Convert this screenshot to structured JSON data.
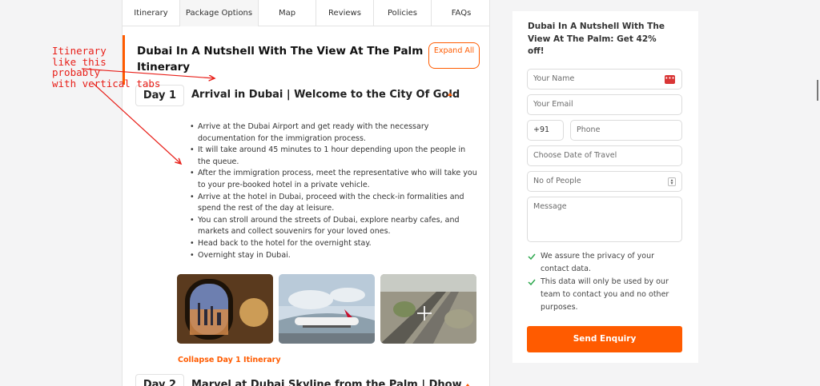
{
  "tabs": [
    {
      "label": "Itinerary"
    },
    {
      "label": "Package Options"
    },
    {
      "label": "Map"
    },
    {
      "label": "Reviews"
    },
    {
      "label": "Policies"
    },
    {
      "label": "FAQs"
    }
  ],
  "itinerary": {
    "title": "Dubai In A Nutshell With The View At The Palm Itinerary",
    "expand_label": "Expand All",
    "days": [
      {
        "day_label": "Day 1",
        "title": "Arrival in Dubai | Welcome to the City Of Gold",
        "bullets": [
          "Arrive at the Dubai Airport and get ready with the necessary documentation for the immigration process.",
          "It will take around 45 minutes to 1 hour depending upon the people in the queue.",
          "After the immigration process, meet the representative who will take you to your pre-booked hotel in a private vehicle.",
          "Arrive at the hotel in Dubai, proceed with the check-in formalities and spend the rest of the day at leisure.",
          "You can stroll around the streets of Dubai, explore nearby cafes, and markets and collect souvenirs for your loved ones.",
          "Head back to the hotel for the overnight stay.",
          "Overnight stay in Dubai."
        ],
        "collapse_label": "Collapse Day 1 Itinerary"
      },
      {
        "day_label": "Day 2",
        "title": "Marvel at Dubai Skyline from the Palm | Dhow"
      }
    ]
  },
  "annotation": "Itinerary\nlike this\nprobably\nwith vertical tabs",
  "form": {
    "title": "Dubai In A Nutshell With The View At The Palm: Get 42% off!",
    "name_placeholder": "Your Name",
    "email_placeholder": "Your Email",
    "country_code": "+91",
    "phone_placeholder": "Phone",
    "date_placeholder": "Choose Date of Travel",
    "people_placeholder": "No of People",
    "message_placeholder": "Message",
    "assurances": [
      "We assure the privacy of your contact data.",
      "This data will only be used by our team to contact you and no other purposes."
    ],
    "send_label": "Send Enquiry"
  },
  "colors": {
    "accent": "#ff5b00",
    "annotation": "#e8201a",
    "check": "#2fa84f"
  }
}
